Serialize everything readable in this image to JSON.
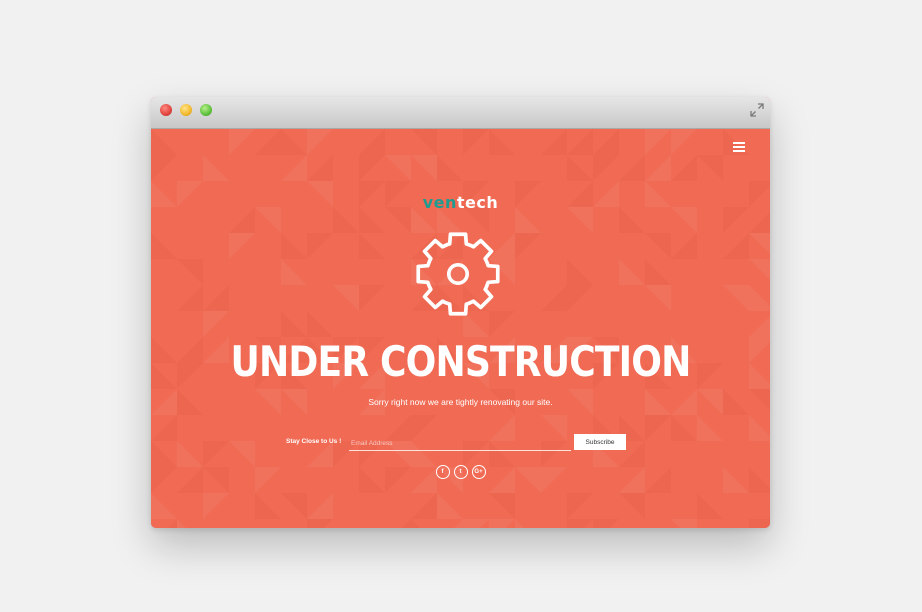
{
  "colors": {
    "background": "#f06a54",
    "logo_accent": "#1f9b90",
    "text": "#ffffff",
    "page_backdrop": "#f1f1f1"
  },
  "window": {
    "controls": [
      "close",
      "minimize",
      "maximize"
    ],
    "fullscreen_icon": "expand-arrows-icon"
  },
  "header": {
    "menu_icon": "hamburger-menu-icon"
  },
  "logo": {
    "part1": "ven",
    "part2": "tech"
  },
  "hero": {
    "icon": "gear-icon",
    "title": "UNDER CONSTRUCTION",
    "subtitle": "Sorry right now we are tightly renovating our site."
  },
  "subscribe": {
    "label": "Stay Close to Us !",
    "email_placeholder": "Email Address",
    "button_label": "Subscribe"
  },
  "social": [
    {
      "icon": "facebook-icon",
      "glyph": "f"
    },
    {
      "icon": "twitter-icon",
      "glyph": "t"
    },
    {
      "icon": "google-plus-icon",
      "glyph": "G+"
    }
  ]
}
